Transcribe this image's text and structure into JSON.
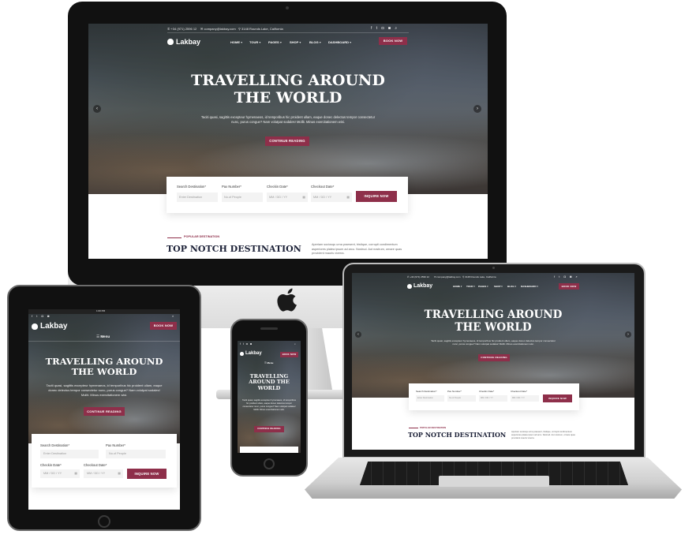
{
  "site": {
    "brand": "Lakbay",
    "phone": "+34 (971) 2596 12",
    "email": "company@lakbay.com",
    "address": "3148 Rounds Lake, California",
    "nav": [
      "HOME",
      "TOUR",
      "PAGES",
      "SHOP",
      "BLOG",
      "DASHBOARD"
    ],
    "menu_label": "Menu",
    "book_now": "BOOK NOW",
    "hero_title_line1": "TRAVELLING AROUND",
    "hero_title_line2": "THE WORLD",
    "hero_title_tablet_line1": "TRAVELLING AROUND",
    "hero_title_tablet_line2": "THE WORLD",
    "hero_title_phone_line1": "TRAVELLING",
    "hero_title_phone_line2": "AROUND THE",
    "hero_title_phone_line3": "WORLD",
    "hero_text": "Taciti quasi, sagittis excepteur hymenaeos, id temporibus hic proident ullam, eaque donec delectus tempor consectetur nunc, purus congue? Nam volutpat sodales! Mollit. Minus exercitationem wisi.",
    "cta": "CONTINUE READING",
    "form": {
      "search_label": "Search Destination*",
      "search_placeholder": "Enter Destination",
      "pax_label": "Pax Number*",
      "pax_placeholder": "No.of People",
      "checkin_label": "Checkin Date*",
      "checkout_label": "Checkout Date*",
      "date_placeholder": "MM / DD / YY",
      "submit": "INQUIRE NOW"
    },
    "section_sub": "POPULAR DESTINATION",
    "section_title": "TOP NOTCH DESTINATION",
    "section_text": "Aperiam sociosqu urna praesent, tristique, corrupti condimentum asperiores platea ipsum ad arcu. Nostrud. Aut nostrum, ornare quas provident mauris viverra.",
    "tablet_time": "1:00 PM"
  },
  "colors": {
    "accent": "#8e2f4a",
    "heading": "#1d2238",
    "device_black": "#111111",
    "silver": "#d6d6d6"
  },
  "icons": {
    "apple": "apple-logo-icon",
    "slider_prev": "chevron-left-icon",
    "slider_next": "chevron-right-icon",
    "calendar": "calendar-icon",
    "search": "search-icon",
    "social": [
      "facebook-icon",
      "twitter-icon",
      "instagram-icon",
      "pinterest-icon"
    ]
  }
}
